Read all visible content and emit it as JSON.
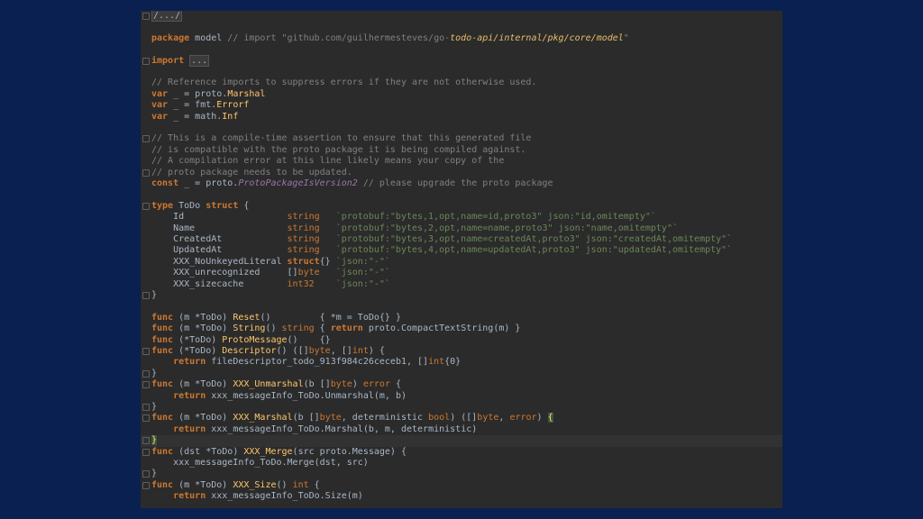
{
  "lines": [
    {
      "tokens": [
        {
          "c": "fold",
          "t": "/.../"
        }
      ],
      "gutter": true
    },
    {
      "tokens": []
    },
    {
      "tokens": [
        {
          "c": "kw",
          "t": "package "
        },
        {
          "c": "",
          "t": "model "
        },
        {
          "c": "cm",
          "t": "// import \"github.com/guilhermesteves/go-"
        },
        {
          "c": "url",
          "t": "todo-api/internal/pkg/core/model"
        },
        {
          "c": "cm",
          "t": "\""
        }
      ]
    },
    {
      "tokens": []
    },
    {
      "tokens": [
        {
          "c": "kw",
          "t": "import "
        },
        {
          "c": "fold",
          "t": "..."
        }
      ],
      "gutter": true
    },
    {
      "tokens": []
    },
    {
      "tokens": [
        {
          "c": "cm",
          "t": "// Reference imports to suppress errors if they are not otherwise used."
        }
      ]
    },
    {
      "tokens": [
        {
          "c": "kw",
          "t": "var "
        },
        {
          "c": "",
          "t": "_ = proto."
        },
        {
          "c": "fn",
          "t": "Marshal"
        }
      ]
    },
    {
      "tokens": [
        {
          "c": "kw",
          "t": "var "
        },
        {
          "c": "",
          "t": "_ = fmt."
        },
        {
          "c": "fn",
          "t": "Errorf"
        }
      ]
    },
    {
      "tokens": [
        {
          "c": "kw",
          "t": "var "
        },
        {
          "c": "",
          "t": "_ = math."
        },
        {
          "c": "fn",
          "t": "Inf"
        }
      ]
    },
    {
      "tokens": []
    },
    {
      "tokens": [
        {
          "c": "cm",
          "t": "// This is a compile-time assertion to ensure that this generated file"
        }
      ],
      "gutter": true
    },
    {
      "tokens": [
        {
          "c": "cm",
          "t": "// is compatible with the proto package it is being compiled against."
        }
      ]
    },
    {
      "tokens": [
        {
          "c": "cm",
          "t": "// A compilation error at this line likely means your copy of the"
        }
      ]
    },
    {
      "tokens": [
        {
          "c": "cm",
          "t": "// proto package needs to be updated."
        }
      ],
      "gutter": true
    },
    {
      "tokens": [
        {
          "c": "kw",
          "t": "const "
        },
        {
          "c": "",
          "t": "_ = proto."
        },
        {
          "c": "ital",
          "t": "ProtoPackageIsVersion2"
        },
        {
          "c": "cm",
          "t": " // please upgrade the proto package"
        }
      ]
    },
    {
      "tokens": []
    },
    {
      "tokens": [
        {
          "c": "kw",
          "t": "type "
        },
        {
          "c": "",
          "t": "ToDo "
        },
        {
          "c": "kw",
          "t": "struct "
        },
        {
          "c": "",
          "t": "{"
        }
      ],
      "gutter": true
    },
    {
      "tokens": [
        {
          "c": "",
          "t": "    Id                   "
        },
        {
          "c": "tp",
          "t": "string"
        },
        {
          "c": "",
          "t": "   "
        },
        {
          "c": "st",
          "t": "`protobuf:\"bytes,1,opt,name=id,proto3\" json:\"id,omitempty\"`"
        }
      ]
    },
    {
      "tokens": [
        {
          "c": "",
          "t": "    Name                 "
        },
        {
          "c": "tp",
          "t": "string"
        },
        {
          "c": "",
          "t": "   "
        },
        {
          "c": "st",
          "t": "`protobuf:\"bytes,2,opt,name=name,proto3\" json:\"name,omitempty\"`"
        }
      ]
    },
    {
      "tokens": [
        {
          "c": "",
          "t": "    CreatedAt            "
        },
        {
          "c": "tp",
          "t": "string"
        },
        {
          "c": "",
          "t": "   "
        },
        {
          "c": "st",
          "t": "`protobuf:\"bytes,3,opt,name=createdAt,proto3\" json:\"createdAt,omitempty\"`"
        }
      ]
    },
    {
      "tokens": [
        {
          "c": "",
          "t": "    UpdatedAt            "
        },
        {
          "c": "tp",
          "t": "string"
        },
        {
          "c": "",
          "t": "   "
        },
        {
          "c": "st",
          "t": "`protobuf:\"bytes,4,opt,name=updatedAt,proto3\" json:\"updatedAt,omitempty\"`"
        }
      ]
    },
    {
      "tokens": [
        {
          "c": "",
          "t": "    XXX_NoUnkeyedLiteral "
        },
        {
          "c": "kw",
          "t": "struct"
        },
        {
          "c": "",
          "t": "{} "
        },
        {
          "c": "st",
          "t": "`json:\"-\"`"
        }
      ]
    },
    {
      "tokens": [
        {
          "c": "",
          "t": "    XXX_unrecognized     []"
        },
        {
          "c": "tp",
          "t": "byte"
        },
        {
          "c": "",
          "t": "   "
        },
        {
          "c": "st",
          "t": "`json:\"-\"`"
        }
      ]
    },
    {
      "tokens": [
        {
          "c": "",
          "t": "    XXX_sizecache        "
        },
        {
          "c": "tp",
          "t": "int32"
        },
        {
          "c": "",
          "t": "    "
        },
        {
          "c": "st",
          "t": "`json:\"-\"`"
        }
      ]
    },
    {
      "tokens": [
        {
          "c": "",
          "t": "}"
        }
      ],
      "gutter": true
    },
    {
      "tokens": []
    },
    {
      "tokens": [
        {
          "c": "kw",
          "t": "func "
        },
        {
          "c": "",
          "t": "(m *ToDo) "
        },
        {
          "c": "fn",
          "t": "Reset"
        },
        {
          "c": "",
          "t": "()         { *m = ToDo{} }"
        }
      ]
    },
    {
      "tokens": [
        {
          "c": "kw",
          "t": "func "
        },
        {
          "c": "",
          "t": "(m *ToDo) "
        },
        {
          "c": "fn",
          "t": "String"
        },
        {
          "c": "",
          "t": "() "
        },
        {
          "c": "tp",
          "t": "string"
        },
        {
          "c": "",
          "t": " { "
        },
        {
          "c": "kw",
          "t": "return "
        },
        {
          "c": "",
          "t": "proto.CompactTextString(m) }"
        }
      ]
    },
    {
      "tokens": [
        {
          "c": "kw",
          "t": "func "
        },
        {
          "c": "",
          "t": "(*ToDo) "
        },
        {
          "c": "fn",
          "t": "ProtoMessage"
        },
        {
          "c": "",
          "t": "()    {}"
        }
      ]
    },
    {
      "tokens": [
        {
          "c": "kw",
          "t": "func "
        },
        {
          "c": "",
          "t": "(*ToDo) "
        },
        {
          "c": "fn",
          "t": "Descriptor"
        },
        {
          "c": "",
          "t": "() ([]"
        },
        {
          "c": "tp",
          "t": "byte"
        },
        {
          "c": "",
          "t": ", []"
        },
        {
          "c": "tp",
          "t": "int"
        },
        {
          "c": "",
          "t": ") {"
        }
      ],
      "gutter": true
    },
    {
      "tokens": [
        {
          "c": "",
          "t": "    "
        },
        {
          "c": "kw",
          "t": "return "
        },
        {
          "c": "",
          "t": "fileDescriptor_todo_913f984c26ceceb1, []"
        },
        {
          "c": "tp",
          "t": "int"
        },
        {
          "c": "",
          "t": "{0}"
        }
      ]
    },
    {
      "tokens": [
        {
          "c": "",
          "t": "}"
        }
      ],
      "gutter": true
    },
    {
      "tokens": [
        {
          "c": "kw",
          "t": "func "
        },
        {
          "c": "",
          "t": "(m *ToDo) "
        },
        {
          "c": "fn",
          "t": "XXX_Unmarshal"
        },
        {
          "c": "",
          "t": "(b []"
        },
        {
          "c": "tp",
          "t": "byte"
        },
        {
          "c": "",
          "t": ") "
        },
        {
          "c": "tp",
          "t": "error"
        },
        {
          "c": "",
          "t": " {"
        }
      ],
      "gutter": true
    },
    {
      "tokens": [
        {
          "c": "",
          "t": "    "
        },
        {
          "c": "kw",
          "t": "return "
        },
        {
          "c": "",
          "t": "xxx_messageInfo_ToDo.Unmarshal(m, b)"
        }
      ]
    },
    {
      "tokens": [
        {
          "c": "",
          "t": "}"
        }
      ],
      "gutter": true
    },
    {
      "tokens": [
        {
          "c": "kw",
          "t": "func "
        },
        {
          "c": "",
          "t": "(m *ToDo) "
        },
        {
          "c": "fn",
          "t": "XXX_Marshal"
        },
        {
          "c": "",
          "t": "(b []"
        },
        {
          "c": "tp",
          "t": "byte"
        },
        {
          "c": "",
          "t": ", deterministic "
        },
        {
          "c": "tp",
          "t": "bool"
        },
        {
          "c": "",
          "t": ") ([]"
        },
        {
          "c": "tp",
          "t": "byte"
        },
        {
          "c": "",
          "t": ", "
        },
        {
          "c": "tp",
          "t": "error"
        },
        {
          "c": "",
          "t": ") "
        },
        {
          "c": "bracehl",
          "t": "{"
        }
      ],
      "gutter": true
    },
    {
      "tokens": [
        {
          "c": "",
          "t": "    "
        },
        {
          "c": "kw",
          "t": "return "
        },
        {
          "c": "",
          "t": "xxx_messageInfo_ToDo.Marshal(b, m, deterministic)"
        }
      ]
    },
    {
      "tokens": [
        {
          "c": "bracehl",
          "t": "}"
        }
      ],
      "gutter": true,
      "current": true
    },
    {
      "tokens": [
        {
          "c": "kw",
          "t": "func "
        },
        {
          "c": "",
          "t": "(dst *ToDo) "
        },
        {
          "c": "fn",
          "t": "XXX_Merge"
        },
        {
          "c": "",
          "t": "(src proto.Message) {"
        }
      ],
      "gutter": true
    },
    {
      "tokens": [
        {
          "c": "",
          "t": "    xxx_messageInfo_ToDo.Merge(dst, src)"
        }
      ]
    },
    {
      "tokens": [
        {
          "c": "",
          "t": "}"
        }
      ],
      "gutter": true
    },
    {
      "tokens": [
        {
          "c": "kw",
          "t": "func "
        },
        {
          "c": "",
          "t": "(m *ToDo) "
        },
        {
          "c": "fn",
          "t": "XXX_Size"
        },
        {
          "c": "",
          "t": "() "
        },
        {
          "c": "tp",
          "t": "int"
        },
        {
          "c": "",
          "t": " {"
        }
      ],
      "gutter": true
    },
    {
      "tokens": [
        {
          "c": "",
          "t": "    "
        },
        {
          "c": "kw",
          "t": "return "
        },
        {
          "c": "",
          "t": "xxx_messageInfo_ToDo.Size(m)"
        }
      ]
    }
  ]
}
